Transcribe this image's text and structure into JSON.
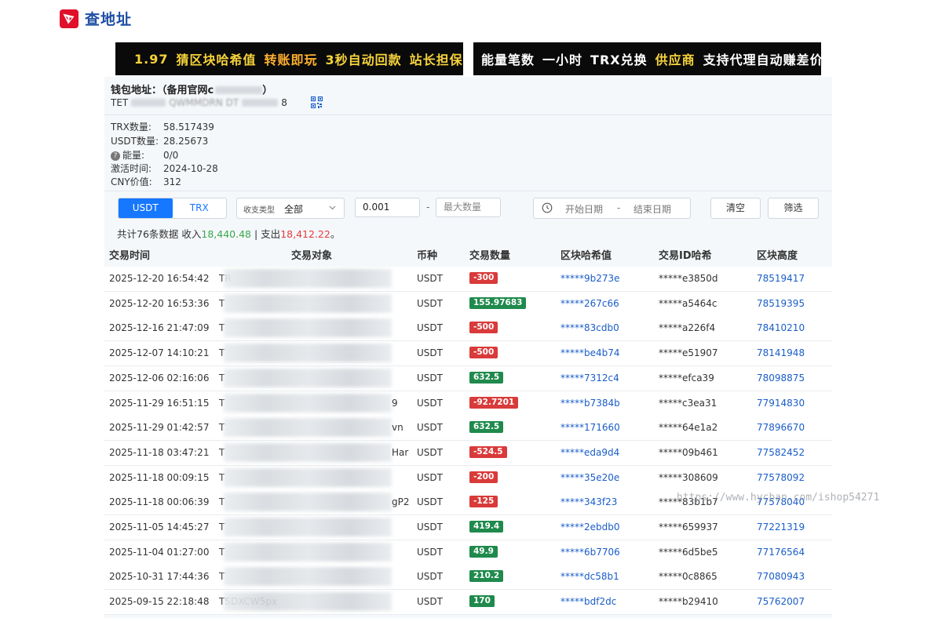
{
  "brand": {
    "title": "查地址"
  },
  "banners": {
    "left": [
      {
        "text": "1.97",
        "color": "yellow"
      },
      {
        "text": "猜区块哈希值",
        "color": "yellow"
      },
      {
        "text": "转账即玩",
        "color": "orange"
      },
      {
        "text": "3秒自动回款",
        "color": "yellow"
      },
      {
        "text": "站长担保",
        "color": "yellow"
      }
    ],
    "right": [
      {
        "text": "能量笔数",
        "color": "white"
      },
      {
        "text": "一小时",
        "color": "white"
      },
      {
        "text": "TRX兑换",
        "color": "white"
      },
      {
        "text": "供应商",
        "color": "yellow"
      },
      {
        "text": "支持代理自动赚差价",
        "color": "white"
      }
    ]
  },
  "wallet": {
    "label": "钱包地址：",
    "note": "（备用官网c",
    "note_end": "）",
    "addr_start": "TET",
    "addr_mid": "QWMMDRN  DT",
    "addr_end": "8",
    "info": [
      {
        "key": "TRX数量:",
        "value": "58.517439"
      },
      {
        "key": "USDT数量:",
        "value": "28.25673"
      },
      {
        "key": "能量:",
        "value": "0/0"
      },
      {
        "key": "激活时间:",
        "value": "2024-10-28"
      },
      {
        "key": "CNY价值:",
        "value": "312"
      }
    ]
  },
  "filters": {
    "tab_usdt": "USDT",
    "tab_trx": "TRX",
    "type_label": "收支类型",
    "type_value": "全部",
    "min_value": "0.001",
    "dash": "-",
    "max_placeholder": "最大数量",
    "start_date": "开始日期",
    "date_dash": "-",
    "end_date": "结束日期",
    "clear": "清空",
    "filter": "筛选"
  },
  "summary": {
    "prefix": "共计76条数据 收入",
    "income": "18,440.48",
    "mid": " | 支出",
    "expense": "18,412.22",
    "suffix": "。"
  },
  "table": {
    "headers": [
      "交易时间",
      "交易对象",
      "币种",
      "交易数量",
      "区块哈希值",
      "交易ID哈希",
      "区块高度"
    ],
    "rows": [
      {
        "time": "2025-12-20 16:54:42",
        "peer": "TR",
        "tail": "",
        "cur": "USDT",
        "amount": "-300",
        "sign": "neg",
        "block": "*****9b273e",
        "tx": "*****e3850d",
        "height": "78519417"
      },
      {
        "time": "2025-12-20 16:53:36",
        "peer": "T",
        "tail": "",
        "cur": "USDT",
        "amount": "155.97683",
        "sign": "pos",
        "block": "*****267c66",
        "tx": "*****a5464c",
        "height": "78519395"
      },
      {
        "time": "2025-12-16 21:47:09",
        "peer": "T",
        "tail": "",
        "cur": "USDT",
        "amount": "-500",
        "sign": "neg",
        "block": "*****83cdb0",
        "tx": "*****a226f4",
        "height": "78410210"
      },
      {
        "time": "2025-12-07 14:10:21",
        "peer": "T",
        "tail": "",
        "cur": "USDT",
        "amount": "-500",
        "sign": "neg",
        "block": "*****be4b74",
        "tx": "*****e51907",
        "height": "78141948"
      },
      {
        "time": "2025-12-06 02:16:06",
        "peer": "T",
        "tail": "",
        "cur": "USDT",
        "amount": "632.5",
        "sign": "pos",
        "block": "*****7312c4",
        "tx": "*****efca39",
        "height": "78098875"
      },
      {
        "time": "2025-11-29 16:51:15",
        "peer": "T",
        "tail": "9",
        "cur": "USDT",
        "amount": "-92.7201",
        "sign": "neg",
        "block": "*****b7384b",
        "tx": "*****c3ea31",
        "height": "77914830"
      },
      {
        "time": "2025-11-29 01:42:57",
        "peer": "T",
        "tail": "vn",
        "cur": "USDT",
        "amount": "632.5",
        "sign": "pos",
        "block": "*****171660",
        "tx": "*****64e1a2",
        "height": "77896670"
      },
      {
        "time": "2025-11-18 03:47:21",
        "peer": "T",
        "tail": "Har",
        "cur": "USDT",
        "amount": "-524.5",
        "sign": "neg",
        "block": "*****eda9d4",
        "tx": "*****09b461",
        "height": "77582452"
      },
      {
        "time": "2025-11-18 00:09:15",
        "peer": "T",
        "tail": "",
        "cur": "USDT",
        "amount": "-200",
        "sign": "neg",
        "block": "*****35e20e",
        "tx": "*****308609",
        "height": "77578092"
      },
      {
        "time": "2025-11-18 00:06:39",
        "peer": "T",
        "tail": "gP2",
        "cur": "USDT",
        "amount": "-125",
        "sign": "neg",
        "block": "*****343f23",
        "tx": "*****83b1b7",
        "height": "77578040"
      },
      {
        "time": "2025-11-05 14:45:27",
        "peer": "T",
        "tail": "",
        "cur": "USDT",
        "amount": "419.4",
        "sign": "pos",
        "block": "*****2ebdb0",
        "tx": "*****659937",
        "height": "77221319"
      },
      {
        "time": "2025-11-04 01:27:00",
        "peer": "T",
        "tail": "",
        "cur": "USDT",
        "amount": "49.9",
        "sign": "pos",
        "block": "*****6b7706",
        "tx": "*****6d5be5",
        "height": "77176564"
      },
      {
        "time": "2025-10-31 17:44:36",
        "peer": "T",
        "tail": "",
        "cur": "USDT",
        "amount": "210.2",
        "sign": "pos",
        "block": "*****dc58b1",
        "tx": "*****0c8865",
        "height": "77080943"
      },
      {
        "time": "2025-09-15 22:18:48",
        "peer": "TSDXCW5px",
        "tail": "",
        "cur": "USDT",
        "amount": "170",
        "sign": "pos",
        "block": "*****bdf2dc",
        "tx": "*****b29410",
        "height": "75762007"
      }
    ]
  },
  "watermark": "https://www.hycban.com/ishop54271",
  "colors": {
    "brand_red": "#e0102a",
    "brand_blue": "#1e4fa3",
    "primary": "#1677ff",
    "negative": "#d93a3a",
    "positive": "#1f8a4c",
    "income_text": "#3aa84b",
    "expense_text": "#e43b3b",
    "link": "#1a5dc9"
  }
}
